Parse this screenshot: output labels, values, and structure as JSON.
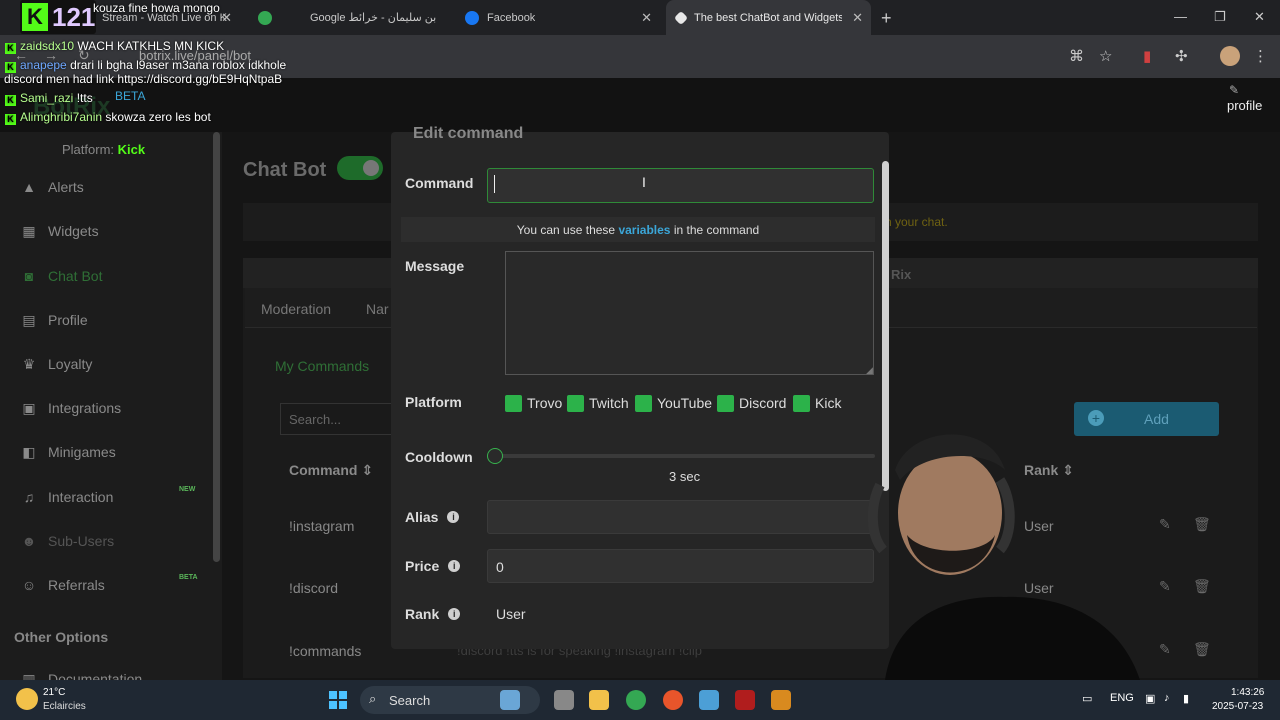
{
  "browser": {
    "tabs": [
      {
        "title": "Stream - Watch Live on K"
      },
      {
        "title": ""
      },
      {
        "title": "Google بن سليمان - خرائط"
      },
      {
        "title": "Facebook"
      },
      {
        "title": "The best ChatBot and Widgets for"
      }
    ],
    "url": "botrix.live/panel/bot"
  },
  "overlay": {
    "logo_letter": "K",
    "logo_number": "121",
    "messages": [
      {
        "user": "",
        "text": "kouza fine howa mongo"
      },
      {
        "user": "zaidsdx10",
        "text": "WACH KATKHLS MN KICK"
      },
      {
        "user": "anapepe",
        "text": "drari li bgha l9aser m3ana roblox idkhole"
      },
      {
        "user": "",
        "text": "discord men had link https://discord.gg/bE9HqNtpaB"
      },
      {
        "user": "Sami_razi",
        "text": "!tts"
      },
      {
        "user": "Alimghribi7anin",
        "text": "skowza zero les bot"
      }
    ],
    "beta": "BETA",
    "botrix": "BotRix"
  },
  "header": {
    "profile": "profile"
  },
  "sidebar": {
    "platform_label": "Platform:",
    "platform_value": "Kick",
    "items": [
      {
        "label": "Alerts"
      },
      {
        "label": "Widgets"
      },
      {
        "label": "Chat Bot"
      },
      {
        "label": "Profile"
      },
      {
        "label": "Loyalty"
      },
      {
        "label": "Integrations"
      },
      {
        "label": "Minigames"
      },
      {
        "label": "Interaction",
        "badge": "NEW"
      },
      {
        "label": "Sub-Users"
      },
      {
        "label": "Referrals",
        "badge": "BETA"
      },
      {
        "label": "Documentation"
      }
    ],
    "other_options": "Other Options"
  },
  "main": {
    "title": "Chat Bot",
    "info_tail": "n your chat.",
    "panel_rix": "Rix",
    "tabs": [
      "Moderation",
      "Nar"
    ],
    "my_commands": "My Commands",
    "search_placeholder": "Search...",
    "add_label": "Add",
    "col_command": "Command",
    "col_rank": "Rank",
    "rows": [
      {
        "command": "!instagram",
        "rank": "User"
      },
      {
        "command": "!discord",
        "rank": "User"
      },
      {
        "command": "!commands",
        "rank": ""
      }
    ],
    "row_desc": "!discord !tts is for speaking !instagram !clip"
  },
  "modal": {
    "title": "Edit command",
    "command_label": "Command",
    "command_value": "",
    "variables_pre": "You can use these",
    "variables_link": "variables",
    "variables_post": "in the command",
    "message_label": "Message",
    "platform_label": "Platform",
    "platforms": [
      "Trovo",
      "Twitch",
      "YouTube",
      "Discord",
      "Kick"
    ],
    "cooldown_label": "Cooldown",
    "cooldown_value": "3 sec",
    "cooldown_fraction": 0,
    "alias_label": "Alias",
    "alias_value": "",
    "price_label": "Price",
    "price_value": "0",
    "rank_label": "Rank",
    "rank_value": "User"
  },
  "taskbar": {
    "temp": "21°C",
    "weather": "Eclaircies",
    "search": "Search",
    "lang": "ENG",
    "time": "1:43:26",
    "date": "2025-07-23"
  },
  "colors": {
    "kick_green": "#53fc18",
    "accent_blue": "#3ba6d8",
    "checkbox_green": "#2cb24a"
  }
}
